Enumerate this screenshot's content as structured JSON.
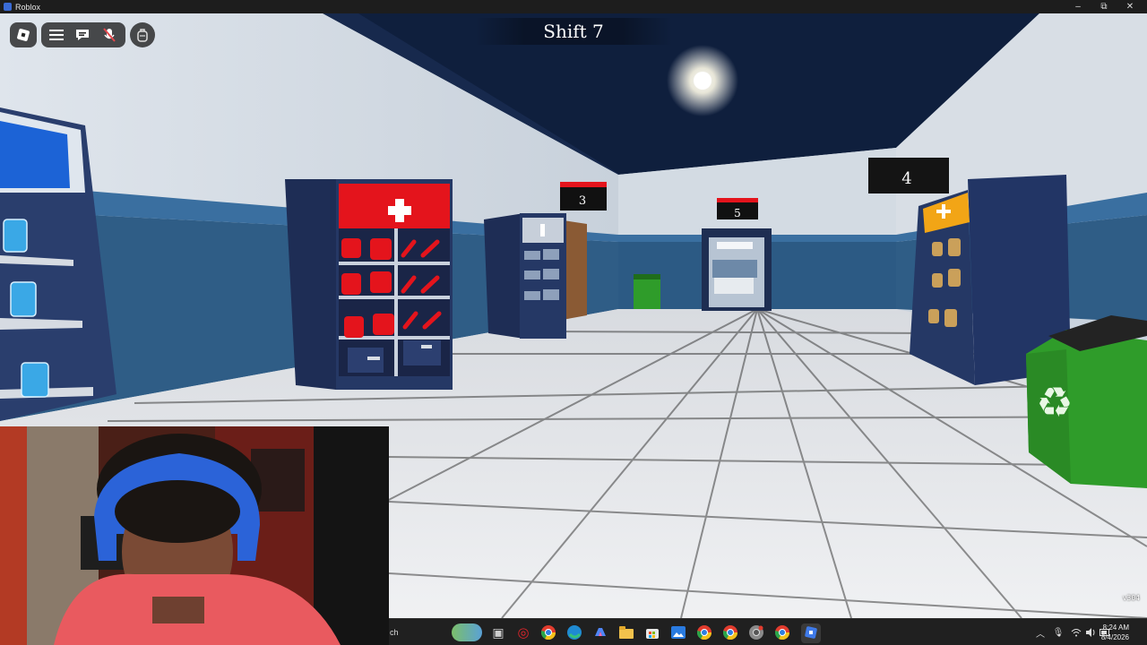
{
  "window": {
    "title": "Roblox",
    "controls": {
      "minimize": "–",
      "maximize": "⧉",
      "close": "✕"
    }
  },
  "hud": {
    "shift_label": "Shift 7",
    "version": "v304",
    "buttons": [
      "roblox-menu-icon",
      "hamburger-menu-icon",
      "chat-icon",
      "microphone-muted-icon",
      "backpack-icon"
    ]
  },
  "scene": {
    "door_numbers": {
      "left": "3",
      "center": "5",
      "right": "4"
    },
    "colors": {
      "wall": "#d3dbe3",
      "wainscot": "#2f5d86",
      "ceiling": "#0f1f3d",
      "floor": "#e3e6ea",
      "cabinet": "#253865",
      "red": "#e4141c",
      "orange": "#f2a516",
      "green": "#2f9c2a"
    }
  },
  "taskbar": {
    "search_text": "ch",
    "clock_time": "8:24 AM",
    "clock_date": "8/4/2026",
    "apps": [
      "widgets-icon",
      "task-view-icon",
      "opera-icon",
      "chrome-icon",
      "edge-icon",
      "copilot-icon",
      "file-explorer-icon",
      "store-icon",
      "photos-icon",
      "chrome-icon",
      "chrome-icon",
      "chrome-icon",
      "chrome-icon",
      "roblox-icon"
    ],
    "tray": [
      "chevron-up-icon",
      "microphone-icon",
      "wifi-icon",
      "speaker-icon",
      "battery-icon"
    ]
  }
}
